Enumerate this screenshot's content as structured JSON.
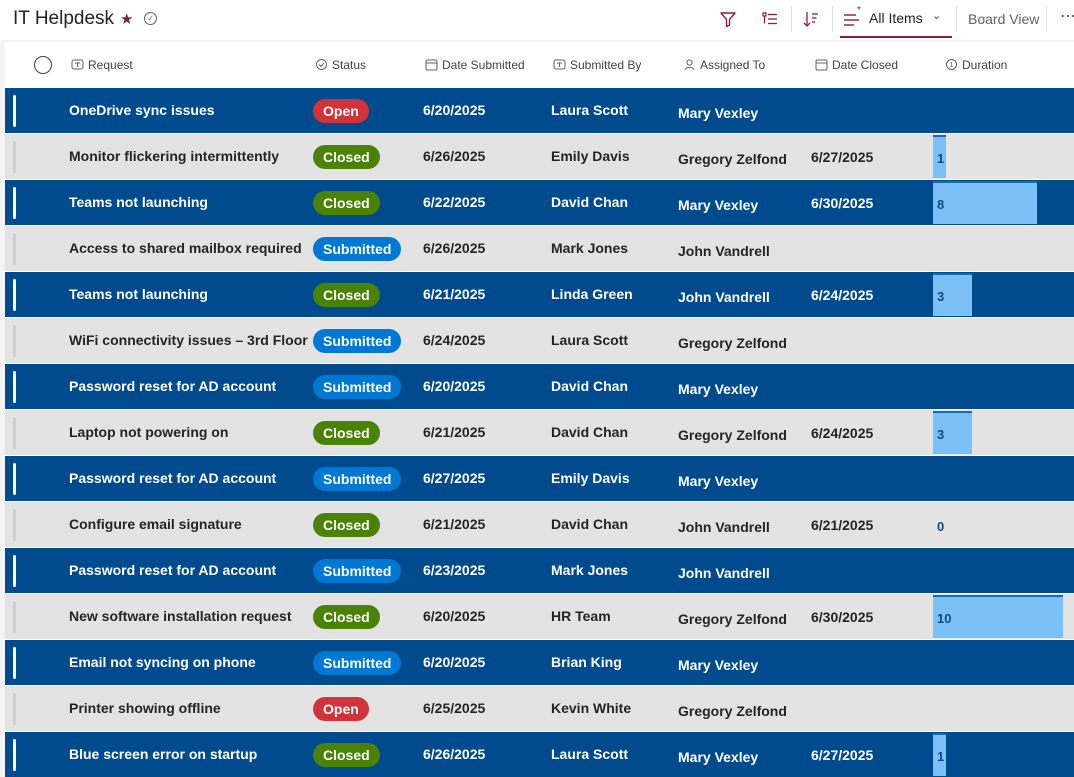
{
  "app": {
    "title": "IT Helpdesk",
    "view_label": "All Items",
    "board_view_label": "Board View"
  },
  "columns": {
    "request": "Request",
    "status": "Status",
    "date_submitted": "Date Submitted",
    "submitted_by": "Submitted By",
    "assigned_to": "Assigned To",
    "date_closed": "Date Closed",
    "duration": "Duration"
  },
  "colors": {
    "row_dark": "#004b8d",
    "row_light": "#e3e3e3",
    "status_open": "#d13438",
    "status_closed": "#498205",
    "status_submitted": "#0078d4",
    "duration_bar": "#7bc0f7"
  },
  "icons": [
    "filter-icon",
    "group-by-icon",
    "sort-icon",
    "view-list-icon",
    "chevron-down-icon",
    "more-icon",
    "favorite-star-icon",
    "check-circle-icon"
  ],
  "duration_scale_max": 10,
  "rows": [
    {
      "request": "OneDrive sync issues",
      "status": "Open",
      "date_submitted": "6/20/2025",
      "submitted_by": "Laura Scott",
      "assigned_to": "Mary Vexley",
      "date_closed": "",
      "duration": ""
    },
    {
      "request": "Monitor flickering intermittently",
      "status": "Closed",
      "date_submitted": "6/26/2025",
      "submitted_by": "Emily Davis",
      "assigned_to": "Gregory Zelfond",
      "date_closed": "6/27/2025",
      "duration": "1"
    },
    {
      "request": "Teams not launching",
      "status": "Closed",
      "date_submitted": "6/22/2025",
      "submitted_by": "David Chan",
      "assigned_to": "Mary Vexley",
      "date_closed": "6/30/2025",
      "duration": "8"
    },
    {
      "request": "Access to shared mailbox required",
      "status": "Submitted",
      "date_submitted": "6/26/2025",
      "submitted_by": "Mark Jones",
      "assigned_to": "John Vandrell",
      "date_closed": "",
      "duration": ""
    },
    {
      "request": "Teams not launching",
      "status": "Closed",
      "date_submitted": "6/21/2025",
      "submitted_by": "Linda Green",
      "assigned_to": "John Vandrell",
      "date_closed": "6/24/2025",
      "duration": "3"
    },
    {
      "request": "WiFi connectivity issues – 3rd Floor",
      "status": "Submitted",
      "date_submitted": "6/24/2025",
      "submitted_by": "Laura Scott",
      "assigned_to": "Gregory Zelfond",
      "date_closed": "",
      "duration": ""
    },
    {
      "request": "Password reset for AD account",
      "status": "Submitted",
      "date_submitted": "6/20/2025",
      "submitted_by": "David Chan",
      "assigned_to": "Mary Vexley",
      "date_closed": "",
      "duration": ""
    },
    {
      "request": "Laptop not powering on",
      "status": "Closed",
      "date_submitted": "6/21/2025",
      "submitted_by": "David Chan",
      "assigned_to": "Gregory Zelfond",
      "date_closed": "6/24/2025",
      "duration": "3"
    },
    {
      "request": "Password reset for AD account",
      "status": "Submitted",
      "date_submitted": "6/27/2025",
      "submitted_by": "Emily Davis",
      "assigned_to": "Mary Vexley",
      "date_closed": "",
      "duration": ""
    },
    {
      "request": "Configure email signature",
      "status": "Closed",
      "date_submitted": "6/21/2025",
      "submitted_by": "David Chan",
      "assigned_to": "John Vandrell",
      "date_closed": "6/21/2025",
      "duration": "0"
    },
    {
      "request": "Password reset for AD account",
      "status": "Submitted",
      "date_submitted": "6/23/2025",
      "submitted_by": "Mark Jones",
      "assigned_to": "John Vandrell",
      "date_closed": "",
      "duration": ""
    },
    {
      "request": "New software installation request",
      "status": "Closed",
      "date_submitted": "6/20/2025",
      "submitted_by": "HR Team",
      "assigned_to": "Gregory Zelfond",
      "date_closed": "6/30/2025",
      "duration": "10"
    },
    {
      "request": "Email not syncing on phone",
      "status": "Submitted",
      "date_submitted": "6/20/2025",
      "submitted_by": "Brian King",
      "assigned_to": "Mary Vexley",
      "date_closed": "",
      "duration": ""
    },
    {
      "request": "Printer showing offline",
      "status": "Open",
      "date_submitted": "6/25/2025",
      "submitted_by": "Kevin White",
      "assigned_to": "Gregory Zelfond",
      "date_closed": "",
      "duration": ""
    },
    {
      "request": "Blue screen error on startup",
      "status": "Closed",
      "date_submitted": "6/26/2025",
      "submitted_by": "Laura Scott",
      "assigned_to": "Mary Vexley",
      "date_closed": "6/27/2025",
      "duration": "1"
    }
  ]
}
